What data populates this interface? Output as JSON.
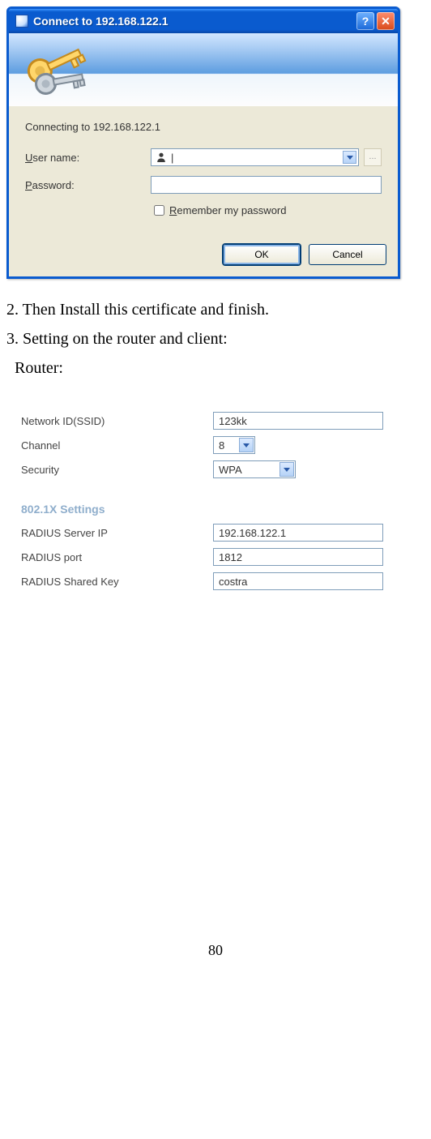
{
  "dialog": {
    "title": "Connect to 192.168.122.1",
    "connecting_text": "Connecting to 192.168.122.1",
    "username_label_pre": "U",
    "username_label_post": "ser name:",
    "username_value": "|",
    "password_label_pre": "P",
    "password_label_post": "assword:",
    "password_value": "",
    "remember_label_pre": "R",
    "remember_label_post": "emember my password",
    "ok_label": "OK",
    "cancel_label": "Cancel",
    "help_glyph": "?",
    "close_glyph": "✕",
    "dots_label": "..."
  },
  "doc": {
    "line2": "2. Then Install this certificate and finish.",
    "line3": "3. Setting on the router and client:",
    "router_label": "  Router:"
  },
  "router": {
    "ssid_label": "Network ID(SSID)",
    "ssid_value": "123kk",
    "channel_label": "Channel",
    "channel_value": "8",
    "security_label": "Security",
    "security_value": "WPA",
    "section_title": "802.1X Settings",
    "radius_ip_label": "RADIUS Server IP",
    "radius_ip_value": "192.168.122.1",
    "radius_port_label": "RADIUS port",
    "radius_port_value": "1812",
    "radius_key_label": "RADIUS Shared Key",
    "radius_key_value": "costra"
  },
  "page_number": "80"
}
